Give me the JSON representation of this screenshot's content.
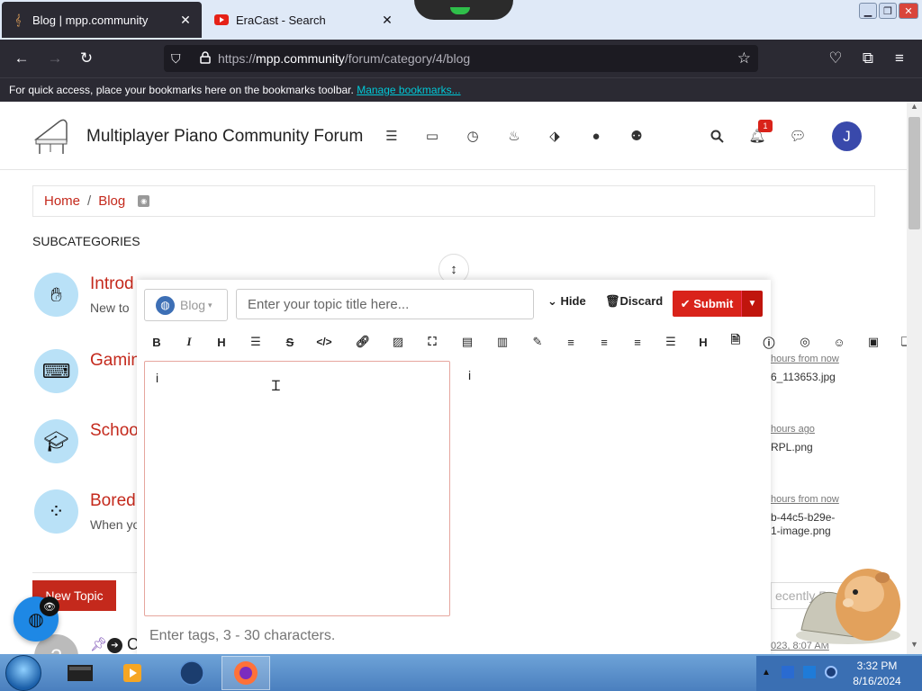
{
  "browser": {
    "tabs": [
      {
        "title": "Blog | mpp.community",
        "active": true
      },
      {
        "title": "EraCast - Search",
        "active": false
      }
    ],
    "url_prefix": "https://",
    "url_host": "mpp.community",
    "url_path": "/forum/category/4/blog",
    "bookmarks_text": "For quick access, place your bookmarks here on the bookmarks toolbar.",
    "bookmarks_link": "Manage bookmarks..."
  },
  "header": {
    "site_title": "Multiplayer Piano Community Forum",
    "notification_count": "1",
    "avatar_letter": "J"
  },
  "breadcrumb": {
    "home": "Home",
    "separator": "/",
    "current": "Blog"
  },
  "subcategories": {
    "label": "SUBCATEGORIES",
    "items": [
      {
        "title": "Introd",
        "desc": "New to",
        "icon": "hand-icon"
      },
      {
        "title": "Gamin",
        "desc": "",
        "icon": "keyboard-icon"
      },
      {
        "title": "Schoo",
        "desc": "",
        "icon": "graduation-cap-icon"
      },
      {
        "title": "Bored",
        "desc": "When yo",
        "icon": "spinner-icon"
      }
    ]
  },
  "recent": [
    {
      "time": "hours from now",
      "file": "6_113653.jpg"
    },
    {
      "time": "hours ago",
      "file": "RPL.png"
    },
    {
      "time": "hours from now",
      "file1": "b-44c5-b29e-",
      "file2": "1-image.png"
    }
  ],
  "topics": {
    "new_topic": "New Topic",
    "sort_placeholder": "ecently R",
    "topic_letter": "C",
    "topic_time": "023, 8:07 AM"
  },
  "composer": {
    "category": "Blog",
    "title_placeholder": "Enter your topic title here...",
    "hide_label": "Hide",
    "discard_label": "Discard",
    "submit_label": "Submit",
    "editor_value": "i",
    "preview_text": "i",
    "tags_placeholder": "Enter tags, 3 - 30 characters."
  },
  "taskbar": {
    "time": "3:32 PM",
    "date": "8/16/2024"
  },
  "colors": {
    "brand_red": "#c4291c",
    "submit_red": "#d9231a",
    "avatar_blue": "#3949ab",
    "category_circle": "#b9e1f7",
    "browser_dark": "#2b2a33"
  }
}
